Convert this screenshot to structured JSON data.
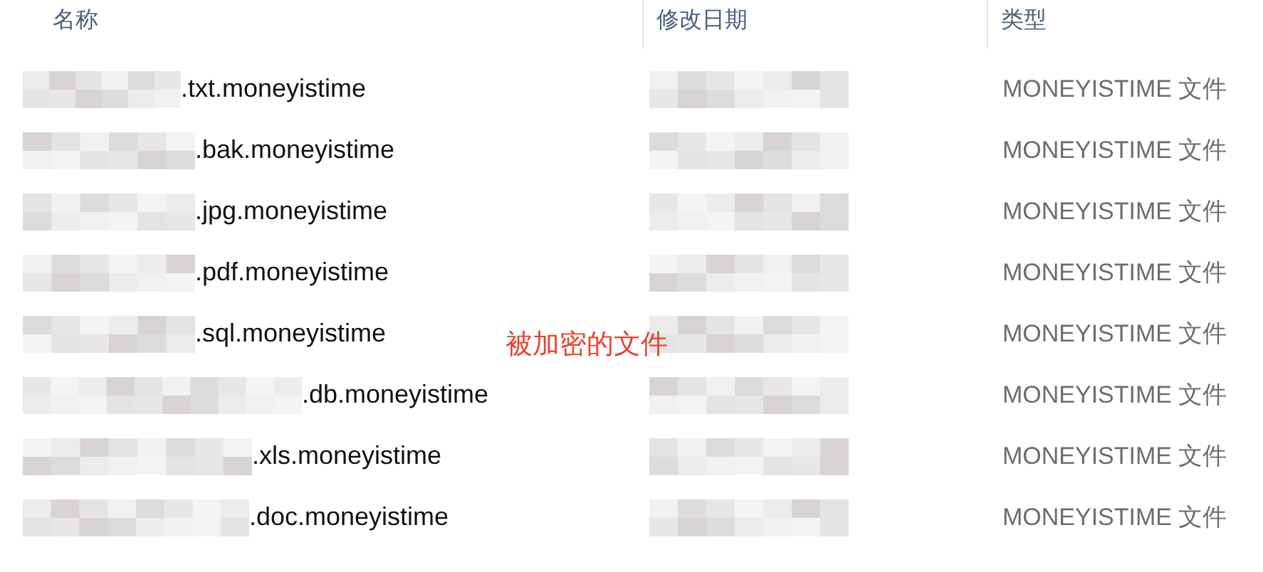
{
  "columns": [
    "名称",
    "修改日期",
    "类型"
  ],
  "rows": [
    {
      "name": ".txt.moneyistime",
      "type": "MONEYISTIME 文件"
    },
    {
      "name": ".bak.moneyistime",
      "type": "MONEYISTIME 文件"
    },
    {
      "name": ".jpg.moneyistime",
      "type": "MONEYISTIME 文件"
    },
    {
      "name": ".pdf.moneyistime",
      "type": "MONEYISTIME 文件"
    },
    {
      "name": ".sql.moneyistime",
      "type": "MONEYISTIME 文件"
    },
    {
      "name": ".db.moneyistime",
      "type": "MONEYISTIME 文件"
    },
    {
      "name": ".xls.moneyistime",
      "type": "MONEYISTIME 文件"
    },
    {
      "name": ".doc.moneyistime",
      "type": "MONEYISTIME 文件"
    }
  ],
  "annotation": "被加密的文件"
}
